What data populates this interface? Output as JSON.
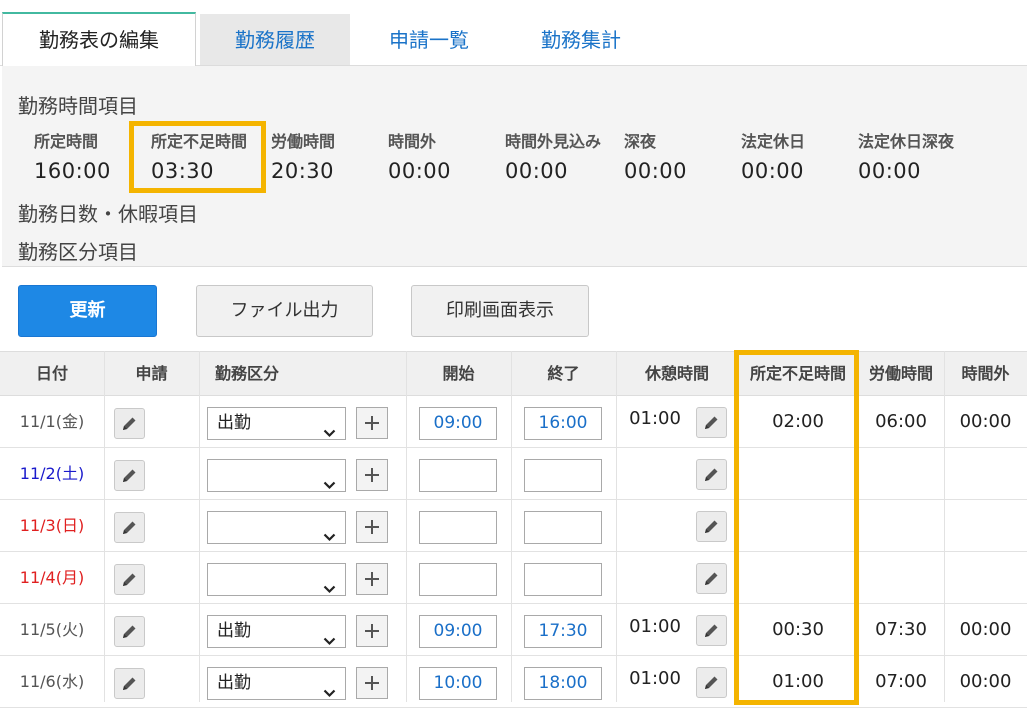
{
  "tabs": [
    {
      "label": "勤務表の編集"
    },
    {
      "label": "勤務履歴"
    },
    {
      "label": "申請一覧"
    },
    {
      "label": "勤務集計"
    }
  ],
  "summary": {
    "work_time_title": "勤務時間項目",
    "metrics": [
      {
        "label": "所定時間",
        "value": "160:00"
      },
      {
        "label": "所定不足時間",
        "value": "03:30"
      },
      {
        "label": "労働時間",
        "value": "20:30"
      },
      {
        "label": "時間外",
        "value": "00:00"
      },
      {
        "label": "時間外見込み",
        "value": "00:00"
      },
      {
        "label": "深夜",
        "value": "00:00"
      },
      {
        "label": "法定休日",
        "value": "00:00"
      },
      {
        "label": "法定休日深夜",
        "value": "00:00"
      }
    ],
    "days_leave_title": "勤務日数・休暇項目",
    "work_category_title": "勤務区分項目"
  },
  "buttons": {
    "update": "更新",
    "file_output": "ファイル出力",
    "print_screen": "印刷画面表示"
  },
  "table": {
    "headers": {
      "date": "日付",
      "request": "申請",
      "category": "勤務区分",
      "start": "開始",
      "end": "終了",
      "break": "休憩時間",
      "shortfall": "所定不足時間",
      "labor": "労働時間",
      "overtime": "時間外"
    },
    "rows": [
      {
        "date": "11/1(金)",
        "day_type": "weekday",
        "category": "出勤",
        "start": "09:00",
        "end": "16:00",
        "break": "01:00",
        "shortfall": "02:00",
        "labor": "06:00",
        "overtime": "00:00"
      },
      {
        "date": "11/2(土)",
        "day_type": "sat",
        "category": "",
        "start": "",
        "end": "",
        "break": "",
        "shortfall": "",
        "labor": "",
        "overtime": ""
      },
      {
        "date": "11/3(日)",
        "day_type": "sun",
        "category": "",
        "start": "",
        "end": "",
        "break": "",
        "shortfall": "",
        "labor": "",
        "overtime": ""
      },
      {
        "date": "11/4(月)",
        "day_type": "hol",
        "category": "",
        "start": "",
        "end": "",
        "break": "",
        "shortfall": "",
        "labor": "",
        "overtime": ""
      },
      {
        "date": "11/5(火)",
        "day_type": "weekday",
        "category": "出勤",
        "start": "09:00",
        "end": "17:30",
        "break": "01:00",
        "shortfall": "00:30",
        "labor": "07:30",
        "overtime": "00:00"
      },
      {
        "date": "11/6(水)",
        "day_type": "weekday",
        "category": "出勤",
        "start": "10:00",
        "end": "18:00",
        "break": "01:00",
        "shortfall": "01:00",
        "labor": "07:00",
        "overtime": "00:00"
      }
    ]
  },
  "colors": {
    "accent": "#1e88e5",
    "highlight": "#f4b400",
    "tab_active_top": "#42b9a0",
    "saturday": "#1a1acc",
    "holiday": "#e02020",
    "time_value": "#1a6fc8"
  },
  "icons": {
    "edit": "pencil-icon",
    "add": "plus-icon",
    "dropdown": "chevron-down-icon"
  }
}
